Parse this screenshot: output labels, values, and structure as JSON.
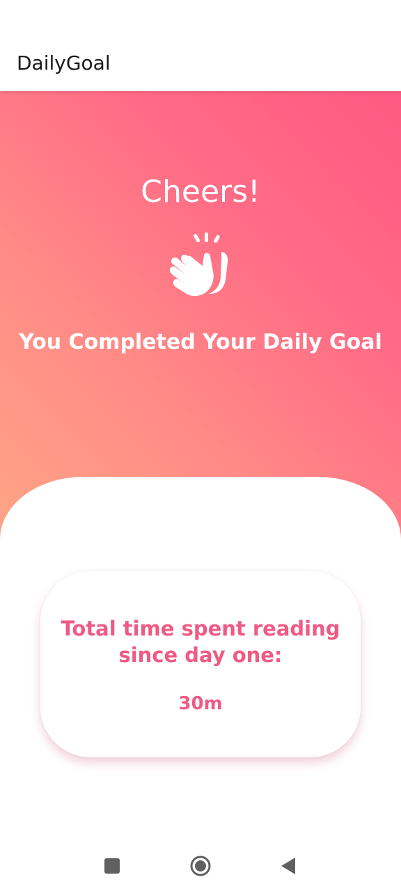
{
  "app_bar": {
    "title": "DailyGoal"
  },
  "hero": {
    "heading": "Cheers!",
    "icon": "clapping-hands-icon",
    "message": "You Completed Your Daily Goal",
    "gradient_colors": [
      "#ff5a82",
      "#ffa985"
    ]
  },
  "stats": {
    "label": "Total time spent reading since day one:",
    "value": "30m",
    "accent_color": "#ee5b84"
  },
  "nav_bar": {
    "buttons": [
      {
        "icon": "square-recents-icon"
      },
      {
        "icon": "circle-home-icon"
      },
      {
        "icon": "triangle-back-icon"
      }
    ]
  }
}
